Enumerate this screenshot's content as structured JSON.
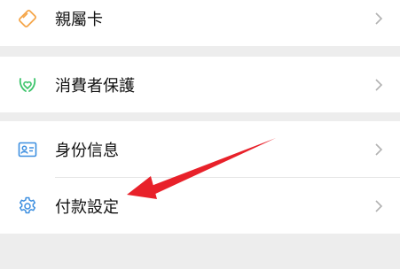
{
  "menu": {
    "groups": [
      {
        "items": [
          {
            "label": "親屬卡",
            "icon": "family-card-icon"
          }
        ]
      },
      {
        "items": [
          {
            "label": "消費者保護",
            "icon": "consumer-protection-icon"
          }
        ]
      },
      {
        "items": [
          {
            "label": "身份信息",
            "icon": "id-card-icon"
          },
          {
            "label": "付款設定",
            "icon": "gear-icon"
          }
        ]
      }
    ]
  },
  "colors": {
    "background": "#ededed",
    "row": "#ffffff",
    "text": "#111111",
    "chevron": "#b2b2b2",
    "icon_orange": "#f5a64a",
    "icon_green": "#3cc46b",
    "icon_blue": "#3d8fe0",
    "annotation_arrow": "#e8212a"
  }
}
